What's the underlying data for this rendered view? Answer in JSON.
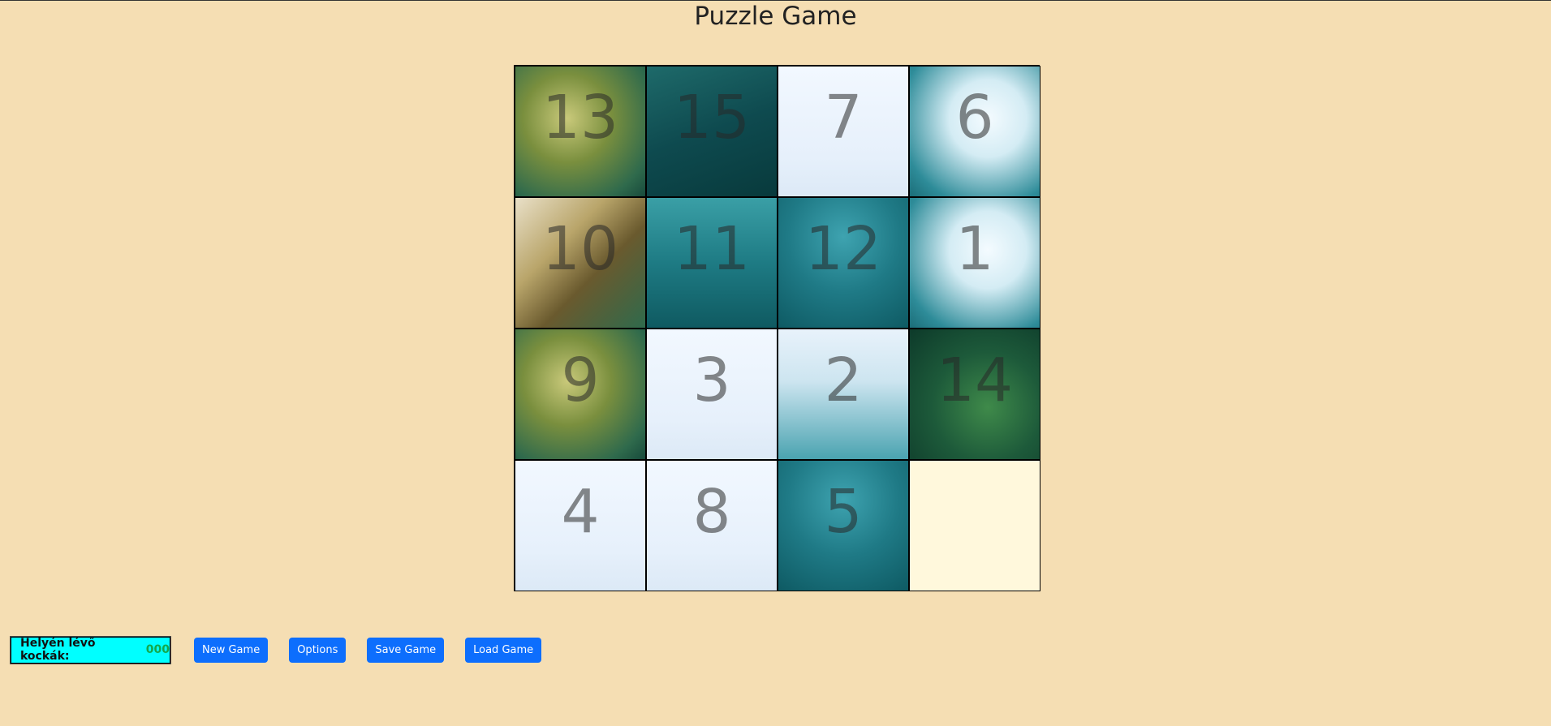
{
  "header": {
    "title": "Puzzle Game"
  },
  "board": {
    "tiles": [
      {
        "number": "13",
        "bg": "bg-fish"
      },
      {
        "number": "15",
        "bg": "bg-deep"
      },
      {
        "number": "7",
        "bg": "bg-sky"
      },
      {
        "number": "6",
        "bg": "bg-water"
      },
      {
        "number": "10",
        "bg": "bg-fishhead"
      },
      {
        "number": "11",
        "bg": "bg-teal"
      },
      {
        "number": "12",
        "bg": "bg-dive"
      },
      {
        "number": "1",
        "bg": "bg-water"
      },
      {
        "number": "9",
        "bg": "bg-fish"
      },
      {
        "number": "3",
        "bg": "bg-sky"
      },
      {
        "number": "2",
        "bg": "bg-split"
      },
      {
        "number": "14",
        "bg": "bg-green"
      },
      {
        "number": "4",
        "bg": "bg-sky"
      },
      {
        "number": "8",
        "bg": "bg-sky"
      },
      {
        "number": "5",
        "bg": "bg-dive"
      },
      {
        "number": "",
        "bg": "empty"
      }
    ]
  },
  "status": {
    "label": "Helyén lévő kockák:",
    "value": "000"
  },
  "buttons": {
    "new_game": "New Game",
    "options": "Options",
    "save_game": "Save Game",
    "load_game": "Load Game"
  },
  "colors": {
    "background": "#f5deb3",
    "counter_bg": "#00ffff",
    "counter_value": "#14a84a",
    "button": "#0d6efd",
    "empty_tile": "#fff8dc"
  }
}
